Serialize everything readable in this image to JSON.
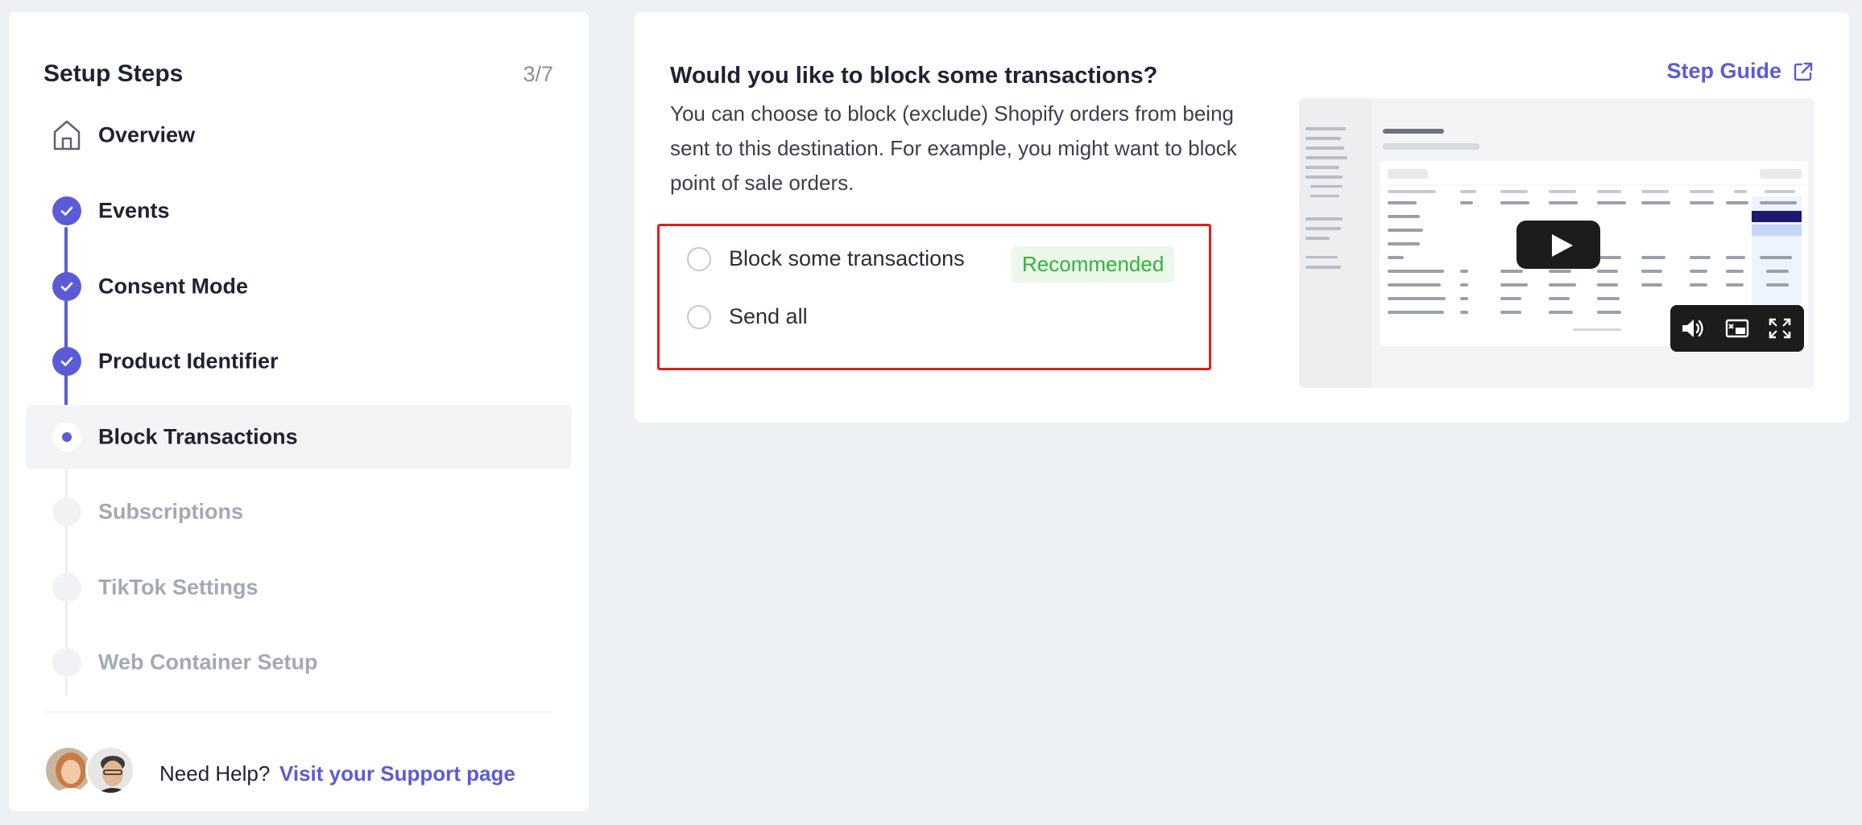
{
  "sidebar": {
    "title": "Setup Steps",
    "progress": "3/7",
    "steps": [
      {
        "label": "Overview",
        "status": "overview"
      },
      {
        "label": "Events",
        "status": "done"
      },
      {
        "label": "Consent Mode",
        "status": "done"
      },
      {
        "label": "Product Identifier",
        "status": "done"
      },
      {
        "label": "Block Transactions",
        "status": "current"
      },
      {
        "label": "Subscriptions",
        "status": "pending"
      },
      {
        "label": "TikTok Settings",
        "status": "pending"
      },
      {
        "label": "Web Container Setup",
        "status": "pending"
      }
    ],
    "help": {
      "text": "Need Help?",
      "link": "Visit your Support page"
    }
  },
  "main": {
    "title": "Would you like to block some transactions?",
    "guide_label": "Step Guide",
    "description": "You can choose to block (exclude) Shopify orders from being sent to this destination. For example, you might want to block point of sale orders.",
    "options": [
      {
        "label": "Block some transactions",
        "badge": "Recommended",
        "selected": false
      },
      {
        "label": "Send all",
        "selected": false
      }
    ]
  },
  "colors": {
    "accent": "#5b5bd6",
    "highlight_border": "#e01e1e",
    "badge_text": "#34b23b",
    "badge_bg": "#eaf7ea"
  },
  "icons": {
    "overview": "home-icon",
    "done": "check-icon",
    "guide": "external-link-icon",
    "video_controls": [
      "volume-icon",
      "cast-icon",
      "fullscreen-icon"
    ]
  }
}
